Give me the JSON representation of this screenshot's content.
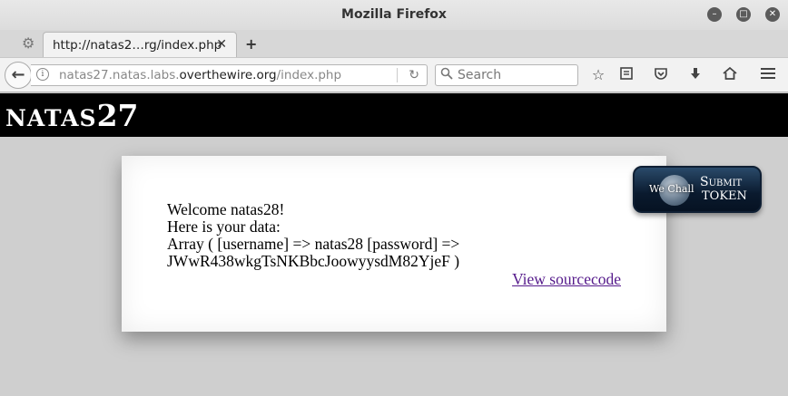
{
  "window": {
    "title": "Mozilla Firefox",
    "minimize_glyph": "–",
    "maximize_glyph": "□",
    "close_glyph": "✕"
  },
  "tabs": [
    {
      "title": "http://natas2…rg/index.php",
      "close_glyph": "✕"
    }
  ],
  "toolbar": {
    "new_tab_glyph": "+",
    "back_glyph": "←",
    "url_prefix": "natas27.natas.labs.",
    "url_domain": "overthewire.org",
    "url_suffix": "/index.php",
    "reload_glyph": "↻",
    "search_placeholder": "Search",
    "icons": [
      "bookmark-star-icon",
      "reading-list-icon",
      "pocket-icon",
      "download-icon",
      "home-icon",
      "menu-icon"
    ]
  },
  "page": {
    "logo_prefix": "NATAS",
    "logo_number": "27",
    "lines": [
      "Welcome natas28!",
      "Here is your data:",
      "Array ( [username] => natas28 [password] =>",
      "JWwR438wkgTsNKBbcJoowyysdM82YjeF )"
    ],
    "source_link": "View sourcecode",
    "submit_badge": {
      "brand": "We Chall",
      "line1": "Submit",
      "line2": "TOKEN"
    }
  },
  "colors": {
    "header_bg": "#000000",
    "page_bg": "#cfcfcf",
    "link_visited": "#551a8b"
  }
}
